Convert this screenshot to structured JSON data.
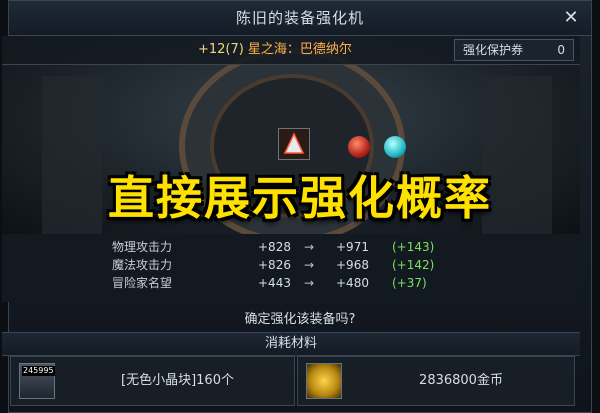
{
  "window": {
    "title": "陈旧的装备强化机"
  },
  "item": {
    "level": "+12(7)",
    "name": "星之海：巴德纳尔"
  },
  "protect": {
    "label": "强化保护券",
    "count": "0"
  },
  "banner": "直接展示强化概率",
  "stats": [
    {
      "label": "物理攻击力",
      "before": "+828",
      "arrow": "→",
      "after": "+971",
      "diff": "(+143)"
    },
    {
      "label": "魔法攻击力",
      "before": "+826",
      "arrow": "→",
      "after": "+968",
      "diff": "(+142)"
    },
    {
      "label": "冒险家名望",
      "before": "+443",
      "arrow": "→",
      "after": "+480",
      "diff": "(+37)"
    }
  ],
  "confirm": "确定强化该装备吗?",
  "materials": {
    "header": "消耗材料",
    "crystal": {
      "qty": "245995",
      "text": "[无色小晶块]160个"
    },
    "gold": {
      "text": "2836800金币"
    }
  },
  "colors": {
    "banner": "#ffe100",
    "diff": "#7de05c",
    "item_title": "#ffb24a"
  }
}
